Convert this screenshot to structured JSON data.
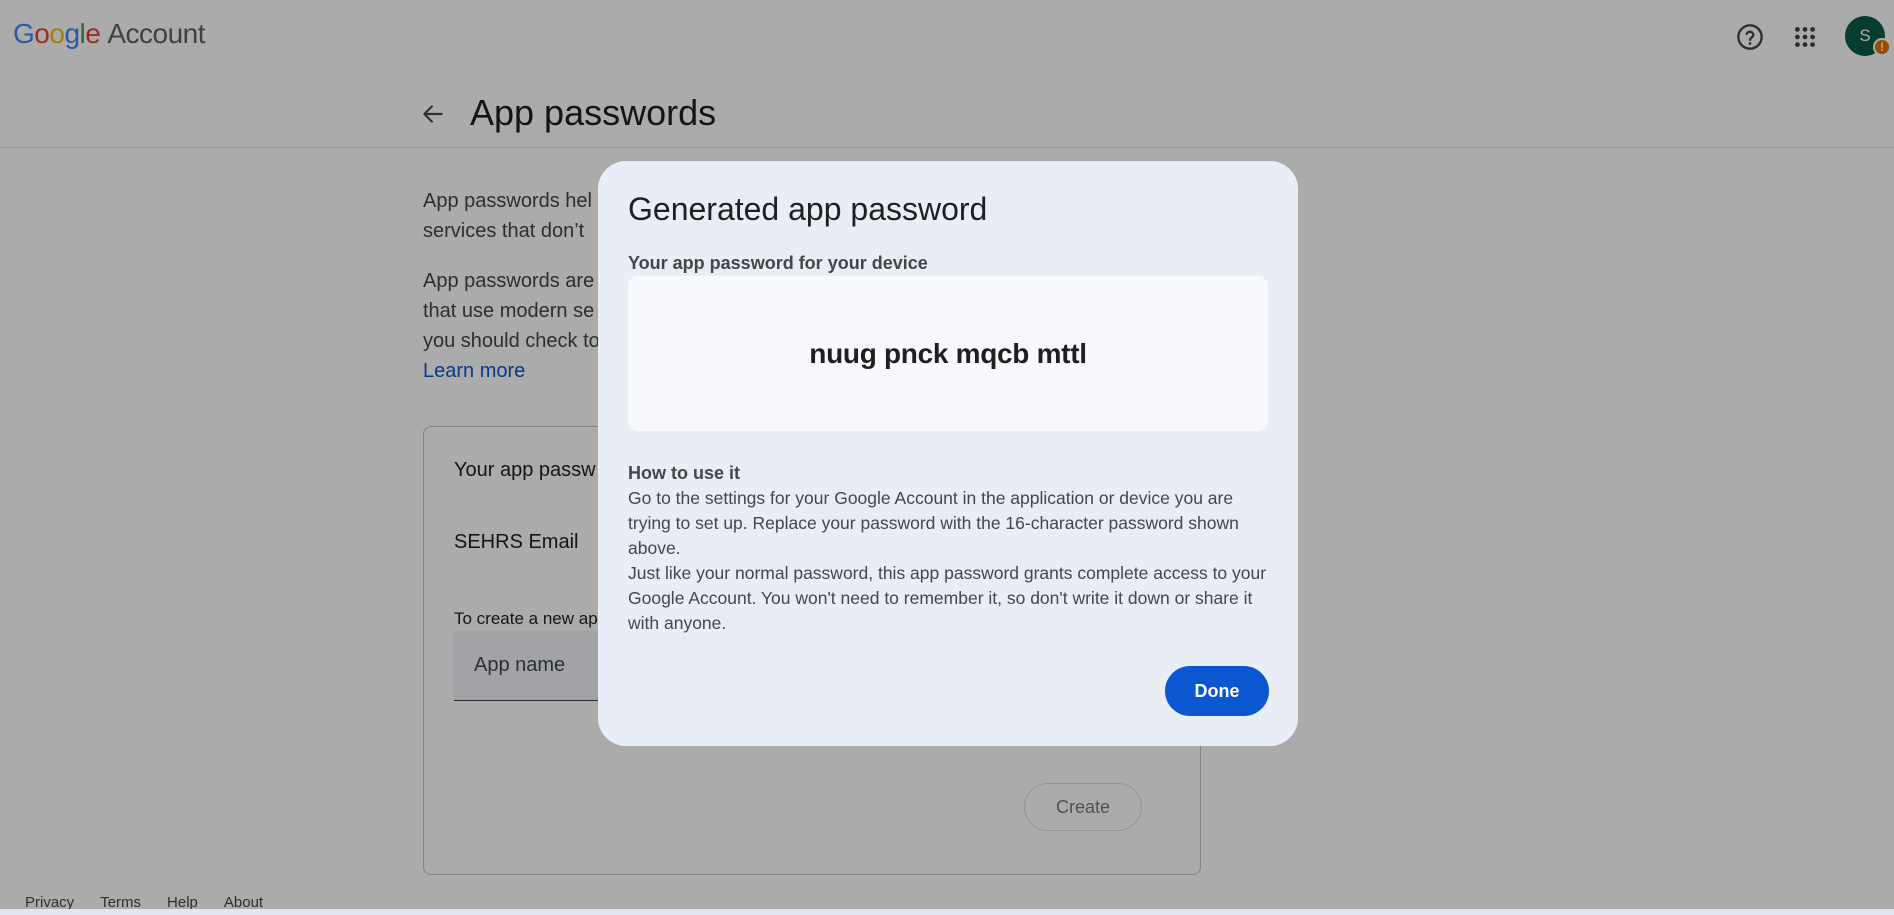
{
  "header": {
    "logo_letters": [
      "G",
      "o",
      "o",
      "g",
      "l",
      "e"
    ],
    "logo_product": "Account",
    "avatar_initial": "S",
    "avatar_badge": "!",
    "colors": {
      "blue": "#4285f4",
      "red": "#ea4335",
      "yellow": "#fbbc05",
      "green": "#34a853",
      "avatar": "#0b5c4a",
      "badge": "#e37400"
    }
  },
  "page": {
    "title": "App passwords"
  },
  "intro": {
    "para1_line1": "App passwords hel",
    "para1_line2": "services that don’t",
    "para2_line1": "App passwords are",
    "para2_line2": "that use modern se",
    "para2_line3": "you should check to",
    "learn_more": "Learn more"
  },
  "card": {
    "title": "Your app passw",
    "entries": [
      {
        "name": "SEHRS Email"
      }
    ],
    "create_hint": "To create a new ap",
    "app_name_placeholder": "App name",
    "create_label": "Create"
  },
  "footer": {
    "links": [
      "Privacy",
      "Terms",
      "Help",
      "About"
    ]
  },
  "dialog": {
    "title": "Generated app password",
    "subtitle": "Your app password for your device",
    "password": "nuug pnck mqcb mttl",
    "howto_title": "How to use it",
    "howto_para1": "Go to the settings for your Google Account in the application or device you are trying to set up. Replace your password with the 16-character password shown above.",
    "howto_para2": "Just like your normal password, this app password grants complete access to your Google Account. You won't need to remember it, so don't write it down or share it with anyone.",
    "done_label": "Done",
    "accent": "#0b57d0"
  }
}
